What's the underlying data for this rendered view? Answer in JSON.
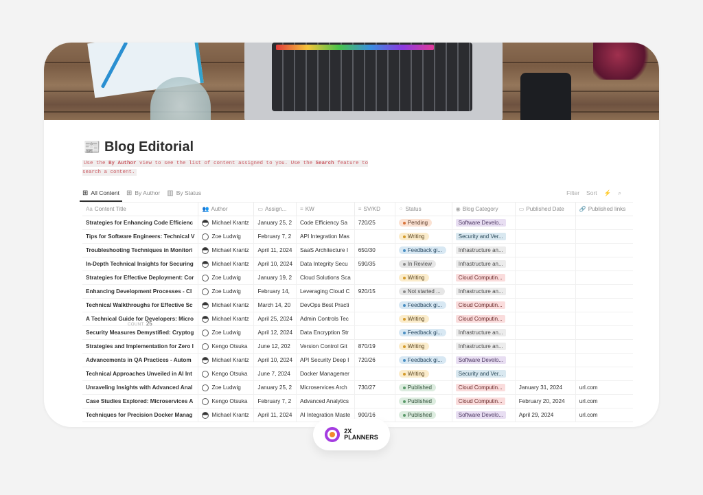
{
  "page": {
    "title": "Blog Editorial",
    "title_icon": "newspaper-icon",
    "description": {
      "part1": "Use the ",
      "bold1": "By Author",
      "part2": " view to see the list of content assigned to you. Use the ",
      "bold2": "Search",
      "part3": " feature to search a content."
    }
  },
  "tabs": [
    {
      "label": "All Content",
      "icon": "table-icon",
      "active": true
    },
    {
      "label": "By Author",
      "icon": "table-icon",
      "active": false
    },
    {
      "label": "By Status",
      "icon": "board-icon",
      "active": false
    }
  ],
  "tools": {
    "filter": "Filter",
    "sort": "Sort",
    "automation": "lightning-icon",
    "search": "search-icon"
  },
  "columns": [
    "Content Title",
    "Author",
    "Assign...",
    "KW",
    "SV/KD",
    "Status",
    "Blog Category",
    "Published Date",
    "Published links"
  ],
  "status_colors": {
    "Pending": {
      "bg": "#fbe2d3",
      "dot": "#d9733a",
      "fg": "#5a3a28"
    },
    "Writing": {
      "bg": "#fbeccb",
      "dot": "#d49a2a",
      "fg": "#5a4520"
    },
    "Feedback gi...": {
      "bg": "#d8e8f3",
      "dot": "#4a8ec2",
      "fg": "#2a4a62"
    },
    "In Review": {
      "bg": "#e6e6e6",
      "dot": "#8a8a8a",
      "fg": "#4a4a4a"
    },
    "Not started ...": {
      "bg": "#e6e6e6",
      "dot": "#8a8a8a",
      "fg": "#4a4a4a"
    },
    "Published": {
      "bg": "#dcecdf",
      "dot": "#5a9a6a",
      "fg": "#2e4e36"
    }
  },
  "category_colors": {
    "Software Develo...": {
      "bg": "#e8def2",
      "fg": "#4a3560"
    },
    "Security and Ver...": {
      "bg": "#d9e8f0",
      "fg": "#2a4a5a"
    },
    "Infrastructure an...": {
      "bg": "#ececec",
      "fg": "#4a4a4a"
    },
    "Cloud Computin...": {
      "bg": "#fadcdc",
      "fg": "#6a2a2a"
    }
  },
  "rows": [
    {
      "title": "Strategies for Enhancing Code Efficienc",
      "author": "Michael Krantz",
      "avatar": "dark",
      "assigned": "January 25, 2",
      "kw": "Code Efficiency Sa",
      "svkd": "720/25",
      "status": "Pending",
      "category": "Software Develo...",
      "published_date": "",
      "link": ""
    },
    {
      "title": "Tips for Software Engineers: Technical V",
      "author": "Zoe Ludwig",
      "avatar": "light",
      "assigned": "February 7, 2",
      "kw": "API Integration Mas",
      "svkd": "",
      "status": "Writing",
      "category": "Security and Ver...",
      "published_date": "",
      "link": ""
    },
    {
      "title": "Troubleshooting Techniques in Monitori",
      "author": "Michael Krantz",
      "avatar": "dark",
      "assigned": "April 11, 2024",
      "kw": "SaaS Architecture I",
      "svkd": "650/30",
      "status": "Feedback gi...",
      "category": "Infrastructure an...",
      "published_date": "",
      "link": ""
    },
    {
      "title": "In-Depth Technical Insights for Securing",
      "author": "Michael Krantz",
      "avatar": "dark",
      "assigned": "April 10, 2024",
      "kw": "Data Integrity Secu",
      "svkd": "590/35",
      "status": "In Review",
      "category": "Infrastructure an...",
      "published_date": "",
      "link": ""
    },
    {
      "title": "Strategies for Effective Deployment: Cor",
      "author": "Zoe Ludwig",
      "avatar": "light",
      "assigned": "January 19, 2",
      "kw": "Cloud Solutions Sca",
      "svkd": "",
      "status": "Writing",
      "category": "Cloud Computin...",
      "published_date": "",
      "link": ""
    },
    {
      "title": "Enhancing Development Processes - CI",
      "author": "Zoe Ludwig",
      "avatar": "light",
      "assigned": "February 14,",
      "kw": "Leveraging Cloud C",
      "svkd": "920/15",
      "status": "Not started ...",
      "category": "Infrastructure an...",
      "published_date": "",
      "link": ""
    },
    {
      "title": "Technical Walkthroughs for Effective Sc",
      "author": "Michael Krantz",
      "avatar": "dark",
      "assigned": "March 14, 20",
      "kw": "DevOps Best Practi",
      "svkd": "",
      "status": "Feedback gi...",
      "category": "Cloud Computin...",
      "published_date": "",
      "link": ""
    },
    {
      "title": "A Technical Guide for Developers: Micro",
      "author": "Michael Krantz",
      "avatar": "dark",
      "assigned": "April 25, 2024",
      "kw": "Admin Controls Tec",
      "svkd": "",
      "status": "Writing",
      "category": "Cloud Computin...",
      "published_date": "",
      "link": ""
    },
    {
      "title": "Security Measures Demystified: Cryptog",
      "author": "Zoe Ludwig",
      "avatar": "light",
      "assigned": "April 12, 2024",
      "kw": "Data Encryption Str",
      "svkd": "",
      "status": "Feedback gi...",
      "category": "Infrastructure an...",
      "published_date": "",
      "link": ""
    },
    {
      "title": "Strategies and Implementation for Zero I",
      "author": "Kengo Otsuka",
      "avatar": "light",
      "assigned": "June 12, 202",
      "kw": "Version Control Git",
      "svkd": "870/19",
      "status": "Writing",
      "category": "Infrastructure an...",
      "published_date": "",
      "link": ""
    },
    {
      "title": "Advancements in QA Practices - Autom",
      "author": "Michael Krantz",
      "avatar": "dark",
      "assigned": "April 10, 2024",
      "kw": "API Security Deep I",
      "svkd": "720/26",
      "status": "Feedback gi...",
      "category": "Software Develo...",
      "published_date": "",
      "link": ""
    },
    {
      "title": "Technical Approaches Unveiled in AI Int",
      "author": "Kengo Otsuka",
      "avatar": "light",
      "assigned": "June 7, 2024",
      "kw": "Docker Managemer",
      "svkd": "",
      "status": "Writing",
      "category": "Security and Ver...",
      "published_date": "",
      "link": ""
    },
    {
      "title": "Unraveling Insights with Advanced Anal",
      "author": "Zoe Ludwig",
      "avatar": "light",
      "assigned": "January 25, 2",
      "kw": "Microservices Arch",
      "svkd": "730/27",
      "status": "Published",
      "category": "Cloud Computin...",
      "published_date": "January 31, 2024",
      "link": "url.com"
    },
    {
      "title": "Case Studies Explored: Microservices A",
      "author": "Kengo Otsuka",
      "avatar": "light",
      "assigned": "February 7, 2",
      "kw": "Advanced Analytics",
      "svkd": "",
      "status": "Published",
      "category": "Cloud Computin...",
      "published_date": "February 20, 2024",
      "link": "url.com"
    },
    {
      "title": "Techniques for Precision Docker Manag",
      "author": "Michael Krantz",
      "avatar": "dark",
      "assigned": "April 11, 2024",
      "kw": "AI Integration Maste",
      "svkd": "900/16",
      "status": "Published",
      "category": "Software Develo...",
      "published_date": "April 29, 2024",
      "link": "url.com"
    }
  ],
  "footer": {
    "count_label": "COUNT",
    "count_value": "25"
  },
  "brand": {
    "line1": "2X",
    "line2": "PLANNERS"
  }
}
